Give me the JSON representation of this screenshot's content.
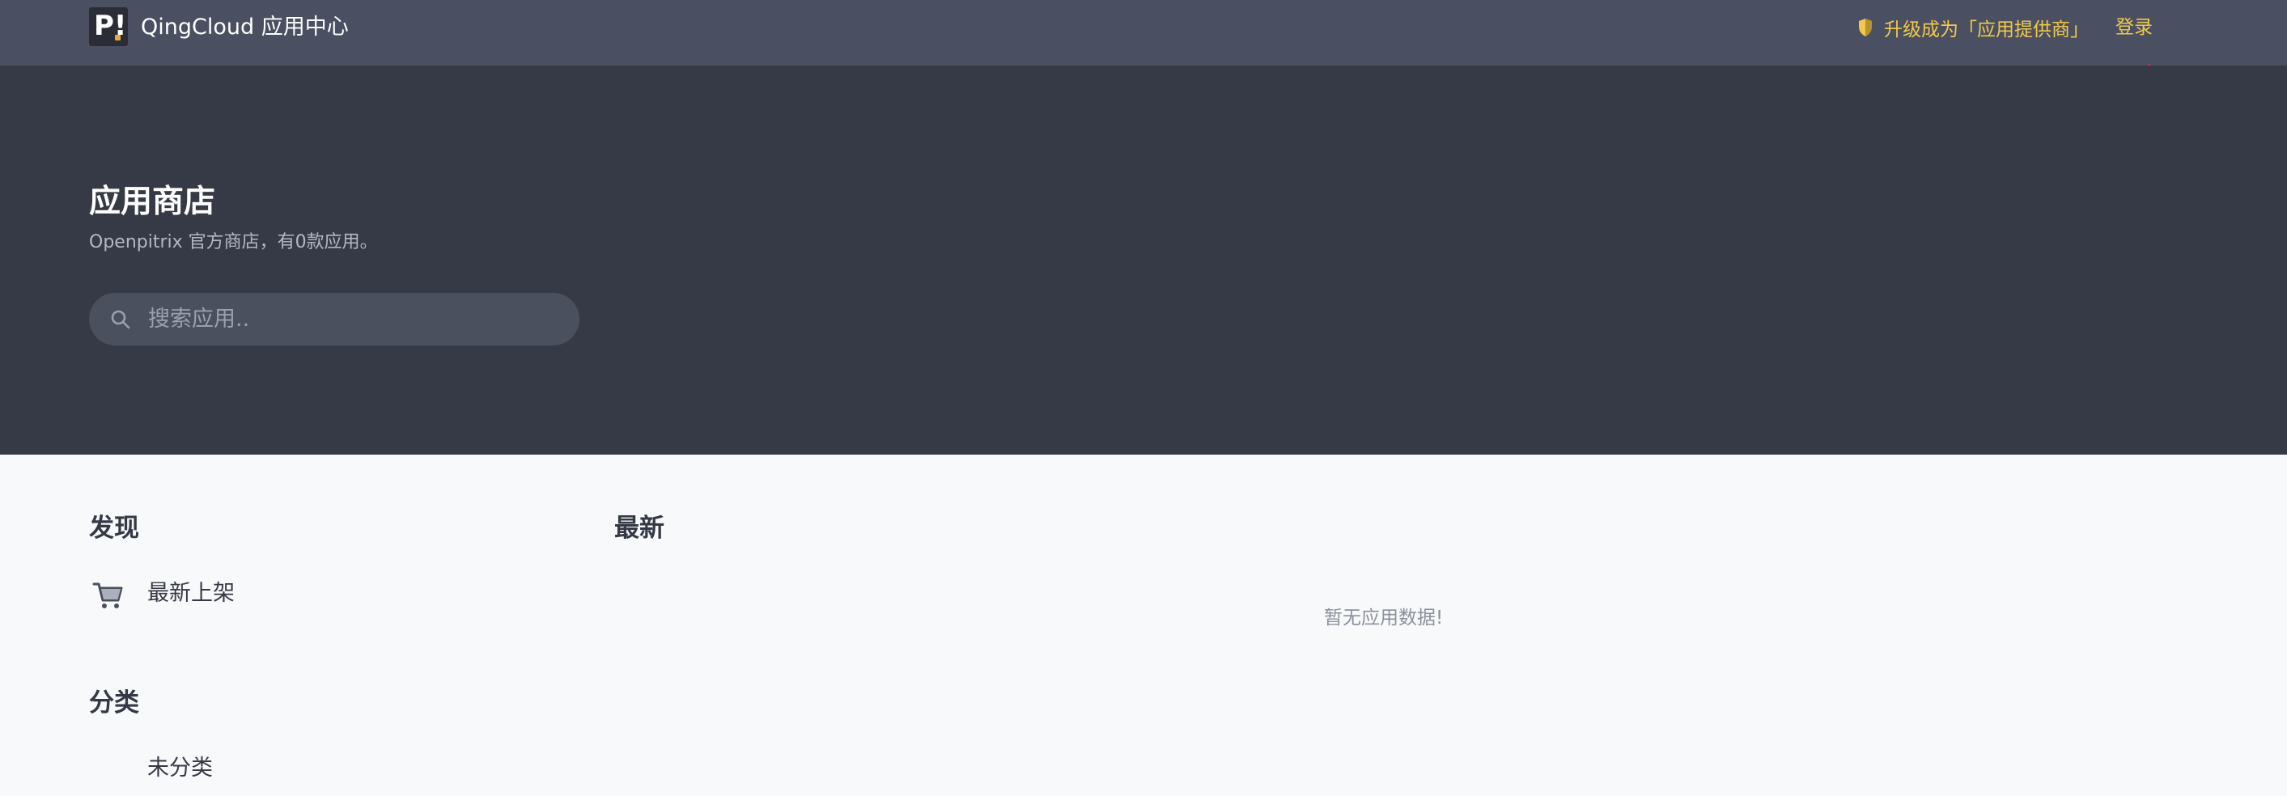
{
  "header": {
    "logo_text": "P!",
    "app_title": "QingCloud 应用中心",
    "upgrade_label": "升级成为「应用提供商」",
    "login_label": "登录"
  },
  "hero": {
    "title": "应用商店",
    "subtitle": "Openpitrix 官方商店，有0款应用。",
    "search_placeholder": "搜索应用.."
  },
  "sidebar": {
    "discover_title": "发现",
    "discover_items": [
      {
        "label": "最新上架",
        "icon": "shopping-cart-icon"
      }
    ],
    "category_title": "分类",
    "category_items": [
      {
        "label": "未分类"
      }
    ]
  },
  "main": {
    "section_title": "最新",
    "empty_text": "暂无应用数据!"
  },
  "colors": {
    "topbar": "#4a5061",
    "hero": "#363a46",
    "accent_yellow": "#f2c94c",
    "annotation_red": "#d9342b"
  }
}
